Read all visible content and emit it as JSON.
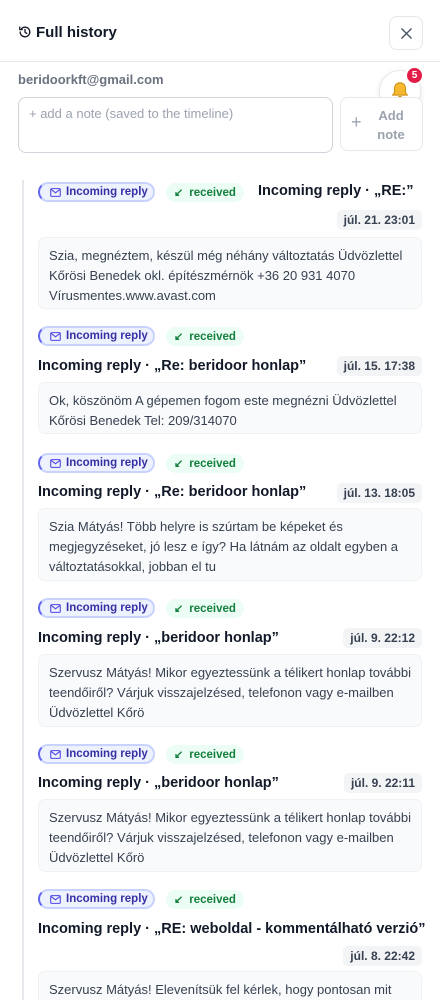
{
  "header": {
    "title": "Full history"
  },
  "contact": {
    "email": "beridoorkft@gmail.com"
  },
  "notifications": {
    "count": "5"
  },
  "note": {
    "placeholder": "+ add a note (saved to the timeline)",
    "add_label": "Add note",
    "add_icon": "+"
  },
  "entries": [
    {
      "type": "Incoming reply",
      "status": "received",
      "title": "Incoming reply · „RE:”",
      "time": "júl. 21. 23:01",
      "body": "Szia, megnéztem, készül még néhány változtatás Üdvözlettel Kőrösi Benedek okl. építészmérnök +36 20 931 4070 Vírusmentes.www.avast.com"
    },
    {
      "type": "Incoming reply",
      "status": "received",
      "title": "Incoming reply · „Re: beridoor honlap”",
      "time": "júl. 15. 17:38",
      "body": "Ok, köszönöm A gépemen fogom este megnézni Üdvözlettel Kőrösi Benedek Tel: 209/314070"
    },
    {
      "type": "Incoming reply",
      "status": "received",
      "title": "Incoming reply · „Re: beridoor honlap”",
      "time": "júl. 13. 18:05",
      "body": "Szia Mátyás! Több helyre is szúrtam be képeket és megjegyzéseket, jó lesz e így? Ha látnám az oldalt egyben a változtatásokkal, jobban el tu"
    },
    {
      "type": "Incoming reply",
      "status": "received",
      "title": "Incoming reply · „beridoor honlap”",
      "time": "júl. 9. 22:12",
      "body": "Szervusz Mátyás! Mikor egyeztessünk a télikert honlap további teendőiről? Várjuk visszajelzésed, telefonon vagy e-mailben Üdvözlettel Kőrö"
    },
    {
      "type": "Incoming reply",
      "status": "received",
      "title": "Incoming reply · „beridoor honlap”",
      "time": "júl. 9. 22:11",
      "body": "Szervusz Mátyás! Mikor egyeztessünk a télikert honlap további teendőiről? Várjuk visszajelzésed, telefonon vagy e-mailben Üdvözlettel Kőrö"
    },
    {
      "type": "Incoming reply",
      "status": "received",
      "title": "Incoming reply · „RE: weboldal - kommentálható verzió”",
      "time": "júl. 8. 22:42",
      "body": "Szervusz Mátyás! Elevenítsük fel kérlek, hogy pontosan mit"
    }
  ]
}
